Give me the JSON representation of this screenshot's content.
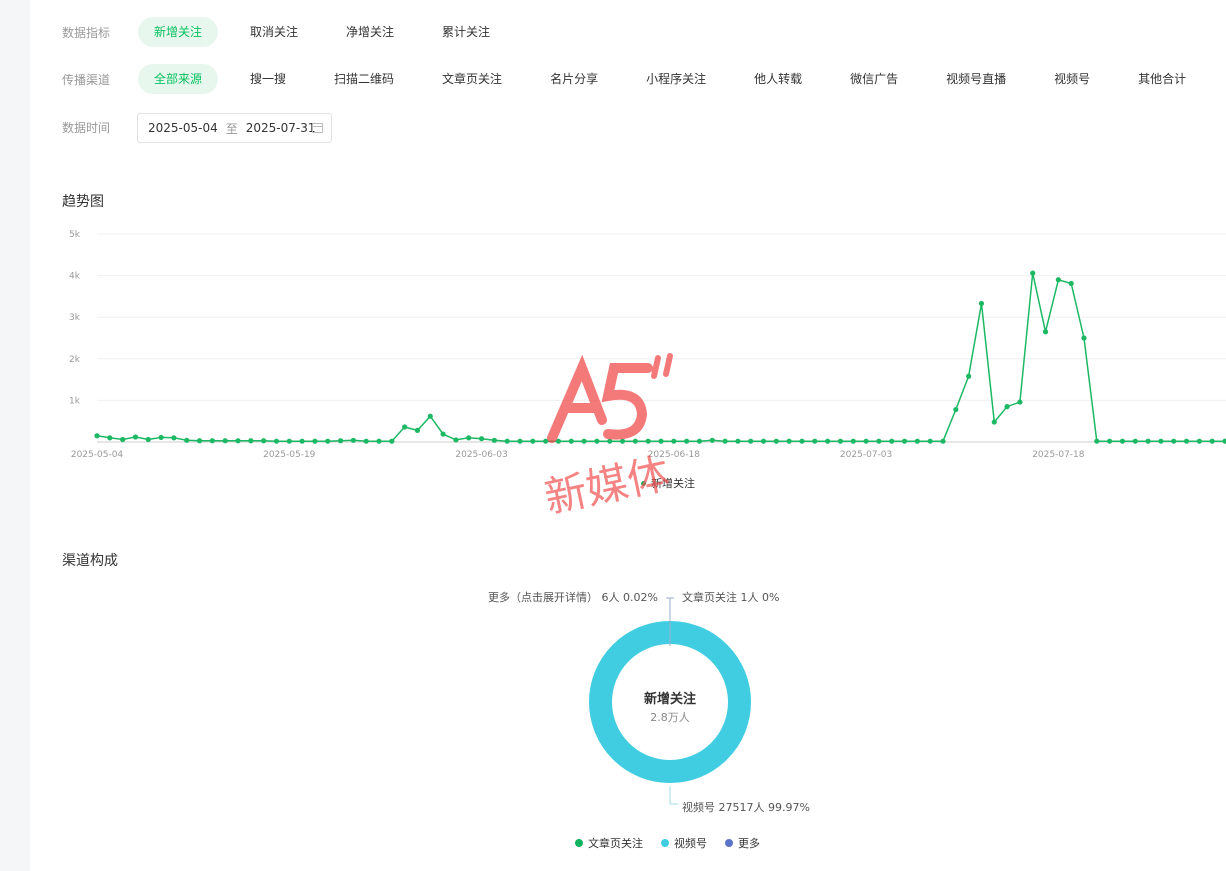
{
  "filters": {
    "metric": {
      "label": "数据指标",
      "options": [
        "新增关注",
        "取消关注",
        "净增关注",
        "累计关注"
      ],
      "active_index": 0
    },
    "channel": {
      "label": "传播渠道",
      "options": [
        "全部来源",
        "搜一搜",
        "扫描二维码",
        "文章页关注",
        "名片分享",
        "小程序关注",
        "他人转载",
        "微信广告",
        "视频号直播",
        "视频号",
        "其他合计"
      ],
      "active_index": 0
    },
    "date": {
      "label": "数据时间",
      "start": "2025-05-04",
      "separator": "至",
      "end": "2025-07-31"
    }
  },
  "trend": {
    "title": "趋势图",
    "legend": "新增关注"
  },
  "composition": {
    "title": "渠道构成",
    "center_title": "新增关注",
    "center_value": "2.8万人",
    "labels": {
      "more": "更多（点击展开详情） 6人 0.02%",
      "article": "文章页关注 1人 0%",
      "video": "视频号 27517人 99.97%"
    },
    "legend": [
      "文章页关注",
      "视频号",
      "更多"
    ]
  },
  "watermark": {
    "logo": "A5",
    "text": "新媒体"
  },
  "colors": {
    "accent": "#07c160",
    "accent_bg": "#e8f7ee",
    "line": "#1db864",
    "donut_video": "#40cde2",
    "legend_article": "#12b25e",
    "legend_video": "#40cde2",
    "legend_more": "#5b73c8",
    "watermark": "#f04848"
  },
  "chart_data": {
    "type": "line",
    "x_ticks": [
      "2025-05-04",
      "2025-05-19",
      "2025-06-03",
      "2025-06-18",
      "2025-07-03",
      "2025-07-18"
    ],
    "y_ticks": [
      "5k",
      "4k",
      "3k",
      "2k",
      "1k"
    ],
    "ylim": [
      0,
      5000
    ],
    "series": [
      {
        "name": "新增关注",
        "x_start": "2025-05-04",
        "x_end": "2025-07-31",
        "values": [
          150,
          100,
          60,
          120,
          60,
          110,
          100,
          40,
          30,
          30,
          30,
          30,
          30,
          30,
          20,
          20,
          20,
          20,
          20,
          30,
          40,
          20,
          20,
          20,
          360,
          280,
          620,
          190,
          50,
          100,
          80,
          40,
          20,
          20,
          20,
          20,
          20,
          20,
          20,
          20,
          20,
          20,
          20,
          20,
          20,
          20,
          20,
          20,
          40,
          20,
          20,
          20,
          20,
          20,
          20,
          20,
          20,
          20,
          20,
          20,
          20,
          20,
          20,
          20,
          20,
          20,
          20,
          780,
          1580,
          3330,
          480,
          850,
          960,
          4060,
          2650,
          3900,
          3810,
          2500,
          20,
          20,
          20,
          20,
          20,
          20,
          20,
          20,
          20,
          20,
          20
        ]
      }
    ]
  }
}
